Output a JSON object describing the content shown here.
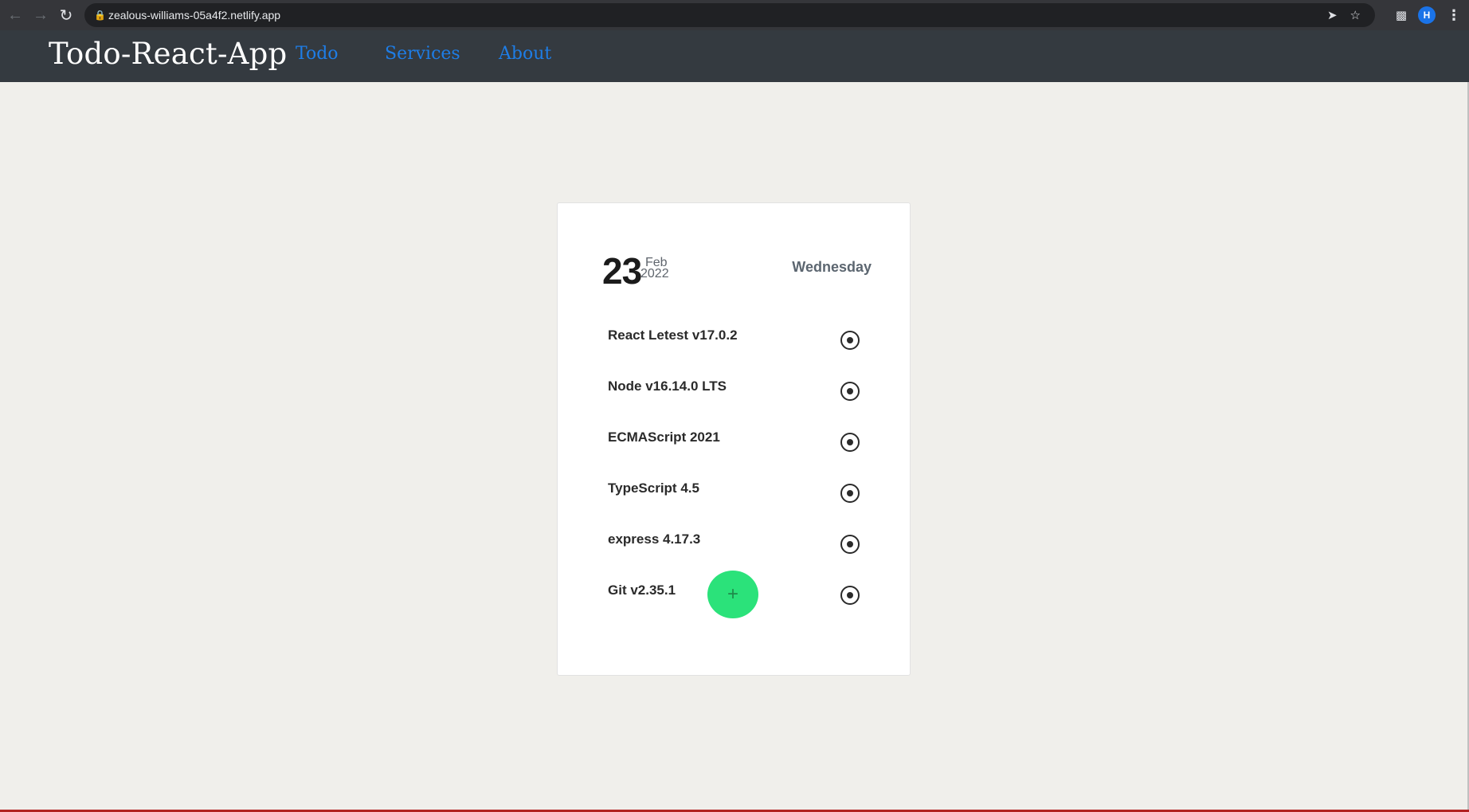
{
  "browser": {
    "url": "zealous-williams-05a4f2.netlify.app",
    "icons": {
      "back": "arrow-left-icon",
      "forward": "arrow-right-icon",
      "reload": "reload-icon",
      "lock": "lock-icon",
      "share": "send-icon",
      "bookmark": "star-icon",
      "extensions": "puzzle-icon",
      "menu": "more-vert-icon"
    },
    "profile_initial": "H"
  },
  "navbar": {
    "brand": "Todo-React-App",
    "links": [
      "Todo",
      "Services",
      "About"
    ],
    "background": "#343a40",
    "link_color": "#1e7de6"
  },
  "card": {
    "day": "23",
    "month": "Feb",
    "year": "2022",
    "weekday": "Wednesday",
    "todos": [
      "React Letest v17.0.2",
      "Node v16.14.0 LTS",
      "ECMAScript 2021",
      "TypeScript 4.5",
      "express 4.17.3",
      "Git v2.35.1"
    ],
    "add_label": "+",
    "add_color": "#2be27a"
  }
}
